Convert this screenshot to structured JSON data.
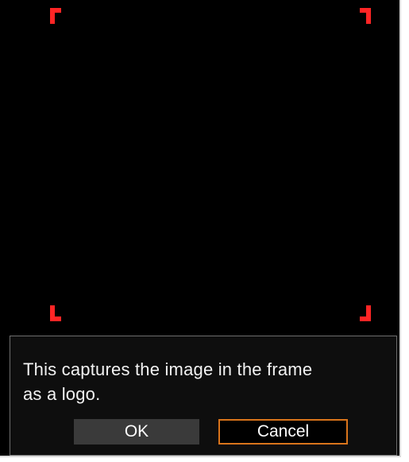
{
  "dialog": {
    "message_line1": "This captures the image in the frame",
    "message_line2": "as a logo.",
    "ok_label": "OK",
    "cancel_label": "Cancel"
  },
  "colors": {
    "frame_marker": "#ff2525",
    "focus_border": "#d9741b",
    "button_fill": "#3a3a3a",
    "screen_background": "#000000"
  },
  "state": {
    "focused_button": "Cancel"
  }
}
